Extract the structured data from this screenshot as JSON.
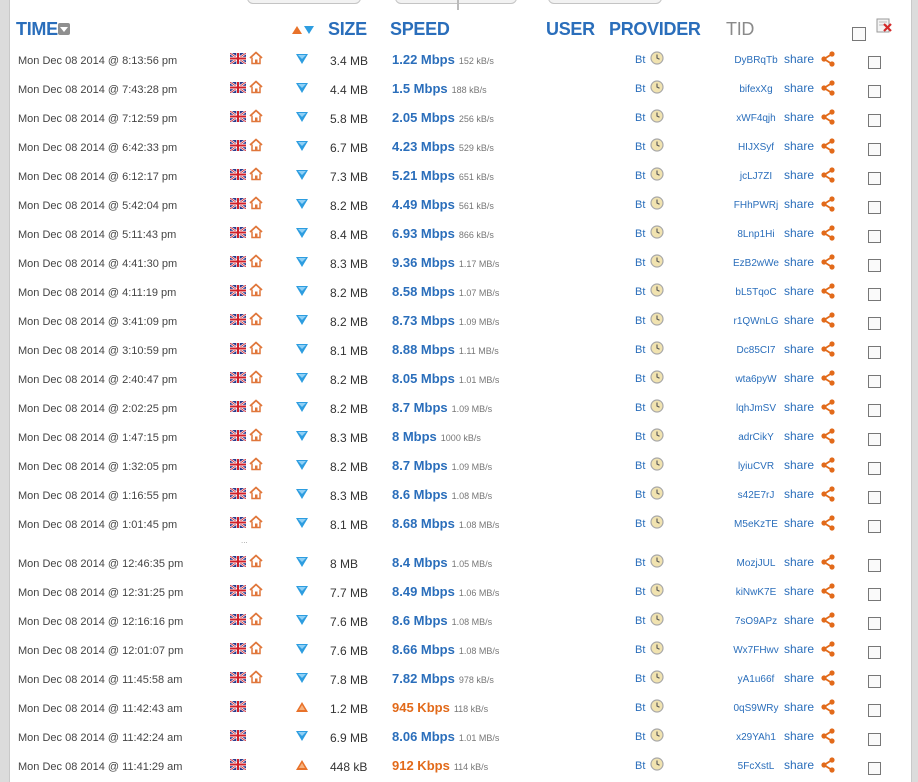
{
  "header": {
    "time": "TIME",
    "size": "SIZE",
    "speed": "SPEED",
    "user": "USER",
    "provider": "PROVIDER",
    "tid": "TID"
  },
  "separator": "...",
  "colors": {
    "blue": "#2a6ebb",
    "orange": "#e26a1a",
    "download": "#2d9de0",
    "upload": "#e8722a"
  },
  "rows": [
    {
      "time": "Mon Dec 08 2014 @ 8:13:56 pm",
      "home": true,
      "dir": "down",
      "size": "3.4 MB",
      "speed": "1.22 Mbps",
      "kbs": "152 kB/s",
      "provider": "Bt",
      "tid": "DyBRqTb",
      "share": "share"
    },
    {
      "time": "Mon Dec 08 2014 @ 7:43:28 pm",
      "home": true,
      "dir": "down",
      "size": "4.4 MB",
      "speed": "1.5 Mbps",
      "kbs": "188 kB/s",
      "provider": "Bt",
      "tid": "bifexXg",
      "share": "share"
    },
    {
      "time": "Mon Dec 08 2014 @ 7:12:59 pm",
      "home": true,
      "dir": "down",
      "size": "5.8 MB",
      "speed": "2.05 Mbps",
      "kbs": "256 kB/s",
      "provider": "Bt",
      "tid": "xWF4qjh",
      "share": "share"
    },
    {
      "time": "Mon Dec 08 2014 @ 6:42:33 pm",
      "home": true,
      "dir": "down",
      "size": "6.7 MB",
      "speed": "4.23 Mbps",
      "kbs": "529 kB/s",
      "provider": "Bt",
      "tid": "HIJXSyf",
      "share": "share"
    },
    {
      "time": "Mon Dec 08 2014 @ 6:12:17 pm",
      "home": true,
      "dir": "down",
      "size": "7.3 MB",
      "speed": "5.21 Mbps",
      "kbs": "651 kB/s",
      "provider": "Bt",
      "tid": "jcLJ7ZI",
      "share": "share"
    },
    {
      "time": "Mon Dec 08 2014 @ 5:42:04 pm",
      "home": true,
      "dir": "down",
      "size": "8.2 MB",
      "speed": "4.49 Mbps",
      "kbs": "561 kB/s",
      "provider": "Bt",
      "tid": "FHhPWRj",
      "share": "share"
    },
    {
      "time": "Mon Dec 08 2014 @ 5:11:43 pm",
      "home": true,
      "dir": "down",
      "size": "8.4 MB",
      "speed": "6.93 Mbps",
      "kbs": "866 kB/s",
      "provider": "Bt",
      "tid": "8Lnp1Hi",
      "share": "share"
    },
    {
      "time": "Mon Dec 08 2014 @ 4:41:30 pm",
      "home": true,
      "dir": "down",
      "size": "8.3 MB",
      "speed": "9.36 Mbps",
      "kbs": "1.17 MB/s",
      "provider": "Bt",
      "tid": "EzB2wWe",
      "share": "share"
    },
    {
      "time": "Mon Dec 08 2014 @ 4:11:19 pm",
      "home": true,
      "dir": "down",
      "size": "8.2 MB",
      "speed": "8.58 Mbps",
      "kbs": "1.07 MB/s",
      "provider": "Bt",
      "tid": "bL5TqoC",
      "share": "share"
    },
    {
      "time": "Mon Dec 08 2014 @ 3:41:09 pm",
      "home": true,
      "dir": "down",
      "size": "8.2 MB",
      "speed": "8.73 Mbps",
      "kbs": "1.09 MB/s",
      "provider": "Bt",
      "tid": "r1QWnLG",
      "share": "share"
    },
    {
      "time": "Mon Dec 08 2014 @ 3:10:59 pm",
      "home": true,
      "dir": "down",
      "size": "8.1 MB",
      "speed": "8.88 Mbps",
      "kbs": "1.11 MB/s",
      "provider": "Bt",
      "tid": "Dc85CI7",
      "share": "share"
    },
    {
      "time": "Mon Dec 08 2014 @ 2:40:47 pm",
      "home": true,
      "dir": "down",
      "size": "8.2 MB",
      "speed": "8.05 Mbps",
      "kbs": "1.01 MB/s",
      "provider": "Bt",
      "tid": "wta6pyW",
      "share": "share"
    },
    {
      "time": "Mon Dec 08 2014 @ 2:02:25 pm",
      "home": true,
      "dir": "down",
      "size": "8.2 MB",
      "speed": "8.7 Mbps",
      "kbs": "1.09 MB/s",
      "provider": "Bt",
      "tid": "lqhJmSV",
      "share": "share"
    },
    {
      "time": "Mon Dec 08 2014 @ 1:47:15 pm",
      "home": true,
      "dir": "down",
      "size": "8.3 MB",
      "speed": "8 Mbps",
      "kbs": "1000 kB/s",
      "provider": "Bt",
      "tid": "adrCikY",
      "share": "share"
    },
    {
      "time": "Mon Dec 08 2014 @ 1:32:05 pm",
      "home": true,
      "dir": "down",
      "size": "8.2 MB",
      "speed": "8.7 Mbps",
      "kbs": "1.09 MB/s",
      "provider": "Bt",
      "tid": "lyiuCVR",
      "share": "share"
    },
    {
      "time": "Mon Dec 08 2014 @ 1:16:55 pm",
      "home": true,
      "dir": "down",
      "size": "8.3 MB",
      "speed": "8.6 Mbps",
      "kbs": "1.08 MB/s",
      "provider": "Bt",
      "tid": "s42E7rJ",
      "share": "share"
    },
    {
      "time": "Mon Dec 08 2014 @ 1:01:45 pm",
      "home": true,
      "dir": "down",
      "size": "8.1 MB",
      "speed": "8.68 Mbps",
      "kbs": "1.08 MB/s",
      "provider": "Bt",
      "tid": "M5eKzTE",
      "share": "share"
    },
    {
      "time": "Mon Dec 08 2014 @ 12:46:35 pm",
      "home": true,
      "dir": "down",
      "size": "8 MB",
      "speed": "8.4 Mbps",
      "kbs": "1.05 MB/s",
      "provider": "Bt",
      "tid": "MozjJUL",
      "share": "share"
    },
    {
      "time": "Mon Dec 08 2014 @ 12:31:25 pm",
      "home": true,
      "dir": "down",
      "size": "7.7 MB",
      "speed": "8.49 Mbps",
      "kbs": "1.06 MB/s",
      "provider": "Bt",
      "tid": "kiNwK7E",
      "share": "share"
    },
    {
      "time": "Mon Dec 08 2014 @ 12:16:16 pm",
      "home": true,
      "dir": "down",
      "size": "7.6 MB",
      "speed": "8.6 Mbps",
      "kbs": "1.08 MB/s",
      "provider": "Bt",
      "tid": "7sO9APz",
      "share": "share"
    },
    {
      "time": "Mon Dec 08 2014 @ 12:01:07 pm",
      "home": true,
      "dir": "down",
      "size": "7.6 MB",
      "speed": "8.66 Mbps",
      "kbs": "1.08 MB/s",
      "provider": "Bt",
      "tid": "Wx7FHwv",
      "share": "share"
    },
    {
      "time": "Mon Dec 08 2014 @ 11:45:58 am",
      "home": true,
      "dir": "down",
      "size": "7.8 MB",
      "speed": "7.82 Mbps",
      "kbs": "978 kB/s",
      "provider": "Bt",
      "tid": "yA1u66f",
      "share": "share"
    },
    {
      "time": "Mon Dec 08 2014 @ 11:42:43 am",
      "home": false,
      "dir": "up",
      "size": "1.2 MB",
      "speed": "945 Kbps",
      "kbs": "118 kB/s",
      "provider": "Bt",
      "tid": "0qS9WRy",
      "share": "share"
    },
    {
      "time": "Mon Dec 08 2014 @ 11:42:24 am",
      "home": false,
      "dir": "down",
      "size": "6.9 MB",
      "speed": "8.06 Mbps",
      "kbs": "1.01 MB/s",
      "provider": "Bt",
      "tid": "x29YAh1",
      "share": "share"
    },
    {
      "time": "Mon Dec 08 2014 @ 11:41:29 am",
      "home": false,
      "dir": "up",
      "size": "448 kB",
      "speed": "912 Kbps",
      "kbs": "114 kB/s",
      "provider": "Bt",
      "tid": "5FcXstL",
      "share": "share"
    }
  ]
}
